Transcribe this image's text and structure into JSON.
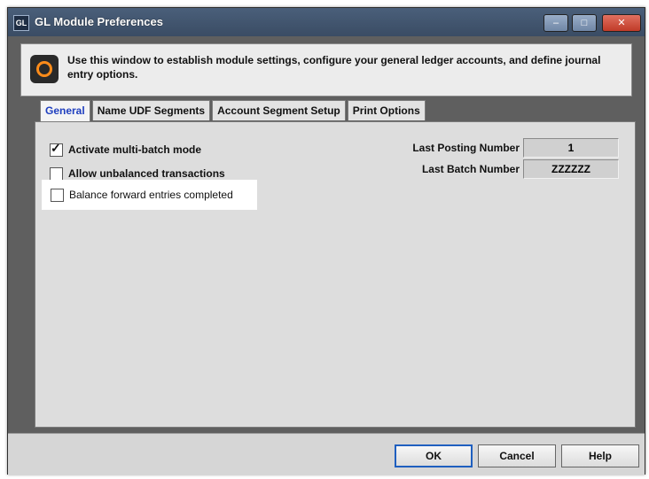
{
  "window": {
    "app_icon": "GL",
    "title": "GL Module Preferences",
    "minimize_glyph": "–",
    "maximize_glyph": "□",
    "close_glyph": "✕"
  },
  "info": {
    "icon": "gear-icon",
    "text": "Use this window to establish module settings, configure your general ledger accounts, and define journal entry options."
  },
  "tabs": [
    {
      "label": "General",
      "active": true
    },
    {
      "label": "Name UDF Segments",
      "active": false
    },
    {
      "label": "Account Segment Setup",
      "active": false
    },
    {
      "label": "Print Options",
      "active": false
    }
  ],
  "general": {
    "checkboxes": [
      {
        "label": "Activate multi-batch mode",
        "checked": true
      },
      {
        "label": "Allow unbalanced transactions",
        "checked": false
      },
      {
        "label": "Balance forward entries completed",
        "checked": false
      }
    ],
    "last_posting_number": {
      "label": "Last Posting Number",
      "value": "1"
    },
    "last_batch_number": {
      "label": "Last Batch Number",
      "value": "ZZZZZZ"
    }
  },
  "buttons": {
    "ok": "OK",
    "cancel": "Cancel",
    "help": "Help"
  }
}
